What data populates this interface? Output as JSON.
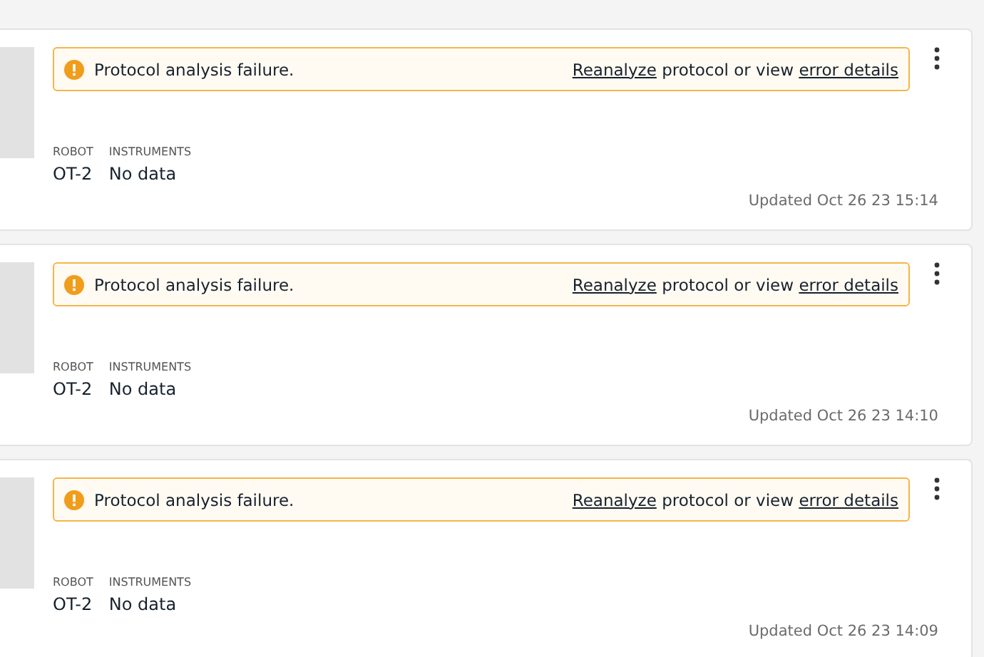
{
  "protocol_cards": [
    {
      "alert": {
        "message": "Protocol analysis failure.",
        "reanalyze_link": "Reanalyze",
        "middle_text": "protocol or view",
        "details_link": "error details"
      },
      "robot_label": "ROBOT",
      "robot": "OT-2",
      "instruments_label": "INSTRUMENTS",
      "instruments": "No data",
      "updated": "Updated Oct 26 23 15:14"
    },
    {
      "alert": {
        "message": "Protocol analysis failure.",
        "reanalyze_link": "Reanalyze",
        "middle_text": "protocol or view",
        "details_link": "error details"
      },
      "robot_label": "ROBOT",
      "robot": "OT-2",
      "instruments_label": "INSTRUMENTS",
      "instruments": "No data",
      "updated": "Updated Oct 26 23 14:10"
    },
    {
      "alert": {
        "message": "Protocol analysis failure.",
        "reanalyze_link": "Reanalyze",
        "middle_text": "protocol or view",
        "details_link": "error details"
      },
      "robot_label": "ROBOT",
      "robot": "OT-2",
      "instruments_label": "INSTRUMENTS",
      "instruments": "No data",
      "updated": "Updated Oct 26 23 14:09"
    }
  ]
}
